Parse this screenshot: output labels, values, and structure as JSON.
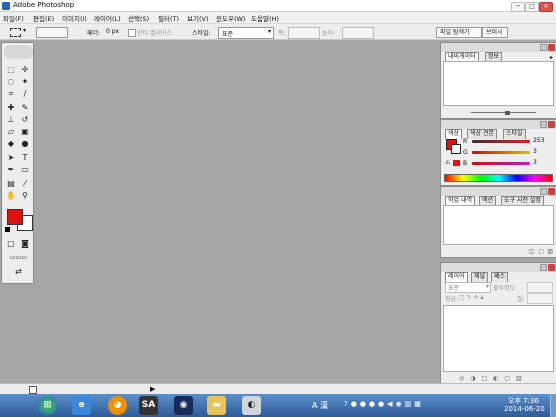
{
  "window": {
    "title": "Adobe Photoshop",
    "buttons": {
      "minimize": "─",
      "maximize": "□",
      "close": "✕"
    }
  },
  "menubar": {
    "items": [
      "파일(F)",
      "편집(E)",
      "이미지(I)",
      "레이어(L)",
      "선택(S)",
      "필터(T)",
      "보기(V)",
      "윈도우(W)",
      "도움말(H)"
    ]
  },
  "options": {
    "feather_label": "페더:",
    "feather_value": "0 px",
    "antialias_label": "안티 앨리어스",
    "style_label": "스타일:",
    "style_value": "표준",
    "width_label": "폭:",
    "height_label": "높이:",
    "well_tabs": [
      "파일 탐색기",
      "브러시"
    ]
  },
  "panels": {
    "navigator": {
      "tabs": [
        "내비게이터",
        "정보"
      ]
    },
    "color": {
      "tabs": [
        "색상",
        "색상 견본",
        "스타일"
      ],
      "channels": [
        {
          "label": "R",
          "value": "253",
          "color": "#e02020"
        },
        {
          "label": "G",
          "value": "3",
          "color": "#d4c000"
        },
        {
          "label": "B",
          "value": "3",
          "color": "#c020c0"
        }
      ]
    },
    "history": {
      "tabs": [
        "작업 내역",
        "액션",
        "도구 사전 설정"
      ]
    },
    "layers": {
      "tabs": [
        "레이어",
        "채널",
        "패스"
      ],
      "blend_mode": "표준",
      "opacity_label": "불투명도:",
      "lock_label": "잠금:",
      "fill_label": "칠:"
    }
  },
  "colors": {
    "foreground": "#e41010",
    "background": "#ffffff"
  },
  "taskbar": {
    "ime": "A 漢",
    "clock_time": "오후 7:36",
    "clock_date": "2014-06-20",
    "app_sa": "SA"
  },
  "statusbar": {
    "arrow": "▶"
  }
}
